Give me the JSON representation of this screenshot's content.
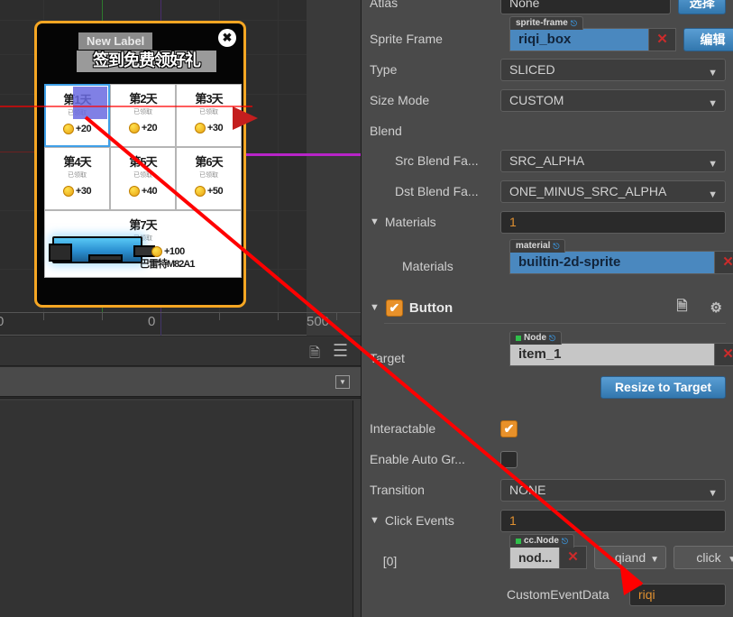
{
  "scene": {
    "node_title_tooltip": "New Label",
    "node_title": "签到免费领好礼",
    "close_icon": "close-circle-icon",
    "ruler": {
      "left_label": "0",
      "center_label": "0",
      "right_label": "500"
    },
    "signin_grid": {
      "days": [
        {
          "day": "第1天",
          "status": "已领取",
          "reward": "+20",
          "selected": true
        },
        {
          "day": "第2天",
          "status": "已领取",
          "reward": "+20",
          "selected": false
        },
        {
          "day": "第3天",
          "status": "已领取",
          "reward": "+30",
          "selected": false
        },
        {
          "day": "第4天",
          "status": "已领取",
          "reward": "+30",
          "selected": false
        },
        {
          "day": "第5天",
          "status": "已领取",
          "reward": "+40",
          "selected": false
        },
        {
          "day": "第6天",
          "status": "已领取",
          "reward": "+50",
          "selected": false
        }
      ],
      "final_day": {
        "day": "第7天",
        "status": "已领取",
        "reward": "+100",
        "item_name": "巴雷特M82A1"
      }
    }
  },
  "inspector": {
    "atlas": {
      "label": "Atlas",
      "value": "None",
      "button": "选择"
    },
    "sprite_frame": {
      "label": "Sprite Frame",
      "tag": "sprite-frame",
      "value": "riqi_box",
      "edit_button": "编辑",
      "clear": "✕"
    },
    "type": {
      "label": "Type",
      "value": "SLICED"
    },
    "size_mode": {
      "label": "Size Mode",
      "value": "CUSTOM"
    },
    "blend": {
      "label": "Blend"
    },
    "src_blend": {
      "label": "Src Blend Fa...",
      "value": "SRC_ALPHA"
    },
    "dst_blend": {
      "label": "Dst Blend Fa...",
      "value": "ONE_MINUS_SRC_ALPHA"
    },
    "materials_section": {
      "label": "Materials",
      "count": "1"
    },
    "materials_item": {
      "label": "Materials",
      "tag": "material",
      "value": "builtin-2d-sprite",
      "clear": "✕"
    },
    "button_section": {
      "label": "Button",
      "enabled": true,
      "check": "✔"
    },
    "target": {
      "label": "Target",
      "tag": "Node",
      "value": "item_1",
      "clear": "✕"
    },
    "resize_button": "Resize to Target",
    "interactable": {
      "label": "Interactable",
      "checked": true,
      "check": "✔"
    },
    "auto_gray": {
      "label": "Enable Auto Gr...",
      "checked": false
    },
    "transition": {
      "label": "Transition",
      "value": "NONE"
    },
    "click_events": {
      "label": "Click Events",
      "count": "1"
    },
    "click_event_row": {
      "index": "[0]",
      "tag": "cc.Node",
      "node_value": "nod...",
      "clear": "✕",
      "component": "qiand",
      "handler": "click"
    },
    "custom_event_data": {
      "label": "CustomEventData",
      "value": "riqi"
    }
  },
  "colors": {
    "panel_bg": "#4a4a4a",
    "canvas_bg": "#2d2d2d",
    "accent_blue": "#4a88bf",
    "accent_orange": "#e8912a",
    "selection_orange": "#f5a623",
    "annotation_red": "#ff0000",
    "magenta_line": "#b824c8"
  }
}
